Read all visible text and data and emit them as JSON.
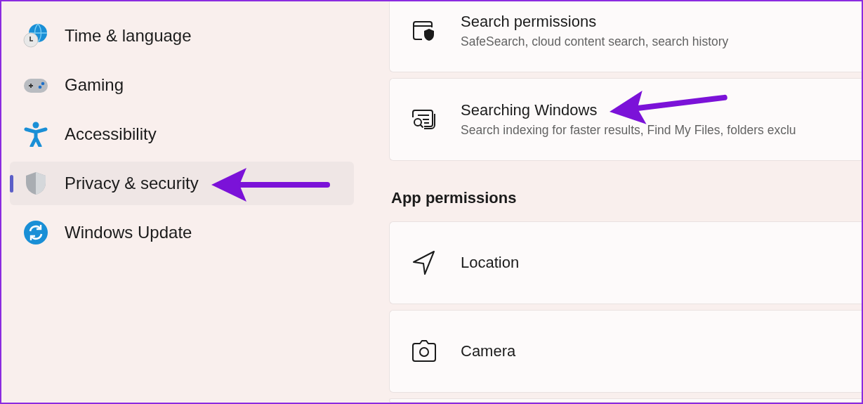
{
  "sidebar": {
    "items": [
      {
        "label": "Time & language",
        "selected": false
      },
      {
        "label": "Gaming",
        "selected": false
      },
      {
        "label": "Accessibility",
        "selected": false
      },
      {
        "label": "Privacy & security",
        "selected": true
      },
      {
        "label": "Windows Update",
        "selected": false
      }
    ]
  },
  "content": {
    "cards_top": [
      {
        "title": "Search permissions",
        "subtitle": "SafeSearch, cloud content search, search history"
      },
      {
        "title": "Searching Windows",
        "subtitle": "Search indexing for faster results, Find My Files, folders exclu"
      }
    ],
    "section_heading": "App permissions",
    "cards": [
      {
        "title": "Location"
      },
      {
        "title": "Camera"
      }
    ]
  },
  "annotations": [
    {
      "kind": "arrow"
    },
    {
      "kind": "arrow"
    }
  ]
}
